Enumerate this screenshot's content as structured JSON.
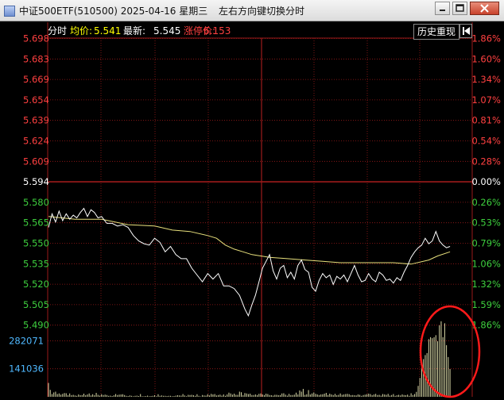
{
  "window": {
    "title": "中证500ETF(510500) 2025-04-16 星期三",
    "hint": "左右方向键切换分时"
  },
  "header": {
    "mode_label": "分时",
    "avg_label": "均价:",
    "avg_value": "5.541",
    "latest_label": "最新:",
    "latest_value": "5.545",
    "limit_label": "涨停价:",
    "limit_value": "6.153",
    "history_button": "历史重现"
  },
  "colors": {
    "up": "#ff4040",
    "down": "#3ecf3e",
    "flat": "#ffffff",
    "price_line": "#ffffff",
    "avg_line": "#e8e07c",
    "grid": "#9c1a1a",
    "volume": "#d9d9a8",
    "volume_label": "#4fb8ff",
    "header_avg": "#ffff00",
    "annotation": "#ff0000"
  },
  "chart_data": {
    "type": "line",
    "base_price": 5.594,
    "price_ticks": [
      "5.698",
      "5.683",
      "5.669",
      "5.654",
      "5.639",
      "5.624",
      "5.609",
      "5.594",
      "5.580",
      "5.565",
      "5.550",
      "5.535",
      "5.520",
      "5.505",
      "5.490"
    ],
    "pct_ticks": [
      "1.86%",
      "1.60%",
      "1.34%",
      "1.07%",
      "0.81%",
      "0.54%",
      "0.28%",
      "0.00%",
      "0.26%",
      "0.53%",
      "0.79%",
      "1.06%",
      "1.32%",
      "1.59%",
      "1.86%"
    ],
    "ylim": [
      5.483,
      5.698
    ],
    "volume_ticks": [
      "282071",
      "141036"
    ],
    "volume_max": 423107,
    "price_series": [
      [
        0,
        5.559
      ],
      [
        2,
        5.569
      ],
      [
        4,
        5.563
      ],
      [
        6,
        5.571
      ],
      [
        8,
        5.564
      ],
      [
        10,
        5.569
      ],
      [
        12,
        5.565
      ],
      [
        14,
        5.568
      ],
      [
        16,
        5.566
      ],
      [
        18,
        5.57
      ],
      [
        20,
        5.573
      ],
      [
        22,
        5.567
      ],
      [
        24,
        5.572
      ],
      [
        26,
        5.57
      ],
      [
        28,
        5.566
      ],
      [
        30,
        5.567
      ],
      [
        33,
        5.562
      ],
      [
        36,
        5.562
      ],
      [
        39,
        5.56
      ],
      [
        42,
        5.561
      ],
      [
        45,
        5.559
      ],
      [
        48,
        5.553
      ],
      [
        51,
        5.549
      ],
      [
        54,
        5.547
      ],
      [
        57,
        5.546
      ],
      [
        60,
        5.551
      ],
      [
        63,
        5.548
      ],
      [
        66,
        5.541
      ],
      [
        69,
        5.545
      ],
      [
        72,
        5.539
      ],
      [
        75,
        5.536
      ],
      [
        78,
        5.536
      ],
      [
        81,
        5.529
      ],
      [
        84,
        5.524
      ],
      [
        87,
        5.519
      ],
      [
        90,
        5.525
      ],
      [
        93,
        5.521
      ],
      [
        96,
        5.525
      ],
      [
        99,
        5.516
      ],
      [
        102,
        5.516
      ],
      [
        105,
        5.514
      ],
      [
        108,
        5.509
      ],
      [
        111,
        5.499
      ],
      [
        113,
        5.494
      ],
      [
        115,
        5.502
      ],
      [
        117,
        5.509
      ],
      [
        119,
        5.519
      ],
      [
        121,
        5.529
      ],
      [
        123,
        5.534
      ],
      [
        125,
        5.539
      ],
      [
        127,
        5.527
      ],
      [
        129,
        5.521
      ],
      [
        131,
        5.529
      ],
      [
        133,
        5.531
      ],
      [
        135,
        5.522
      ],
      [
        137,
        5.526
      ],
      [
        139,
        5.521
      ],
      [
        141,
        5.531
      ],
      [
        143,
        5.535
      ],
      [
        145,
        5.528
      ],
      [
        147,
        5.526
      ],
      [
        149,
        5.515
      ],
      [
        151,
        5.512
      ],
      [
        153,
        5.52
      ],
      [
        155,
        5.525
      ],
      [
        157,
        5.522
      ],
      [
        159,
        5.524
      ],
      [
        161,
        5.517
      ],
      [
        163,
        5.523
      ],
      [
        165,
        5.521
      ],
      [
        167,
        5.524
      ],
      [
        169,
        5.519
      ],
      [
        171,
        5.525
      ],
      [
        173,
        5.531
      ],
      [
        175,
        5.524
      ],
      [
        177,
        5.519
      ],
      [
        179,
        5.52
      ],
      [
        181,
        5.525
      ],
      [
        183,
        5.521
      ],
      [
        185,
        5.519
      ],
      [
        187,
        5.526
      ],
      [
        189,
        5.524
      ],
      [
        191,
        5.52
      ],
      [
        193,
        5.521
      ],
      [
        195,
        5.518
      ],
      [
        197,
        5.522
      ],
      [
        199,
        5.52
      ],
      [
        201,
        5.526
      ],
      [
        203,
        5.531
      ],
      [
        205,
        5.537
      ],
      [
        207,
        5.541
      ],
      [
        209,
        5.544
      ],
      [
        211,
        5.546
      ],
      [
        213,
        5.551
      ],
      [
        215,
        5.547
      ],
      [
        217,
        5.549
      ],
      [
        219,
        5.556
      ],
      [
        221,
        5.549
      ],
      [
        223,
        5.546
      ],
      [
        225,
        5.544
      ],
      [
        227,
        5.545
      ]
    ],
    "avg_series": [
      [
        0,
        5.567
      ],
      [
        15,
        5.565
      ],
      [
        30,
        5.565
      ],
      [
        45,
        5.561
      ],
      [
        60,
        5.56
      ],
      [
        70,
        5.557
      ],
      [
        80,
        5.556
      ],
      [
        90,
        5.553
      ],
      [
        95,
        5.551
      ],
      [
        100,
        5.546
      ],
      [
        105,
        5.543
      ],
      [
        110,
        5.541
      ],
      [
        115,
        5.539
      ],
      [
        125,
        5.537
      ],
      [
        135,
        5.536
      ],
      [
        145,
        5.535
      ],
      [
        155,
        5.534
      ],
      [
        165,
        5.533
      ],
      [
        175,
        5.533
      ],
      [
        185,
        5.533
      ],
      [
        195,
        5.533
      ],
      [
        205,
        5.532
      ],
      [
        215,
        5.535
      ],
      [
        220,
        5.538
      ],
      [
        227,
        5.541
      ]
    ],
    "volume_series": [
      [
        0,
        70000
      ],
      [
        1,
        35000
      ],
      [
        2,
        14000
      ],
      [
        3,
        22000
      ],
      [
        4,
        26000
      ],
      [
        5,
        14000
      ],
      [
        6,
        17000
      ],
      [
        7,
        11000
      ],
      [
        8,
        15000
      ],
      [
        9,
        19000
      ],
      [
        10,
        18000
      ],
      [
        11,
        8000
      ],
      [
        12,
        17000
      ],
      [
        13,
        8000
      ],
      [
        14,
        10000
      ],
      [
        15,
        7000
      ],
      [
        16,
        5000
      ],
      [
        17,
        12000
      ],
      [
        18,
        8000
      ],
      [
        19,
        9000
      ],
      [
        20,
        16000
      ],
      [
        21,
        8000
      ],
      [
        22,
        12000
      ],
      [
        23,
        17000
      ],
      [
        24,
        7000
      ],
      [
        25,
        13000
      ],
      [
        26,
        8000
      ],
      [
        27,
        20000
      ],
      [
        28,
        10000
      ],
      [
        29,
        6000
      ],
      [
        30,
        13000
      ],
      [
        31,
        9000
      ],
      [
        32,
        11000
      ],
      [
        33,
        9000
      ],
      [
        34,
        5000
      ],
      [
        35,
        6000
      ],
      [
        36,
        4000
      ],
      [
        37,
        8000
      ],
      [
        38,
        14000
      ],
      [
        39,
        9000
      ],
      [
        40,
        11000
      ],
      [
        41,
        12000
      ],
      [
        42,
        13000
      ],
      [
        43,
        9000
      ],
      [
        44,
        5000
      ],
      [
        45,
        4000
      ],
      [
        46,
        7000
      ],
      [
        47,
        5000
      ],
      [
        48,
        3000
      ],
      [
        49,
        5000
      ],
      [
        50,
        6000
      ],
      [
        51,
        4000
      ],
      [
        52,
        14000
      ],
      [
        53,
        3000
      ],
      [
        54,
        3000
      ],
      [
        55,
        4000
      ],
      [
        56,
        6000
      ],
      [
        57,
        3000
      ],
      [
        58,
        4000
      ],
      [
        59,
        5000
      ],
      [
        60,
        8000
      ],
      [
        61,
        3000
      ],
      [
        62,
        13000
      ],
      [
        63,
        5000
      ],
      [
        64,
        7000
      ],
      [
        65,
        5000
      ],
      [
        66,
        5000
      ],
      [
        67,
        4000
      ],
      [
        68,
        5000
      ],
      [
        69,
        5000
      ],
      [
        70,
        3000
      ],
      [
        71,
        4000
      ],
      [
        72,
        6000
      ],
      [
        73,
        8000
      ],
      [
        74,
        7000
      ],
      [
        75,
        6000
      ],
      [
        76,
        14000
      ],
      [
        77,
        7000
      ],
      [
        78,
        3000
      ],
      [
        79,
        10000
      ],
      [
        80,
        9000
      ],
      [
        81,
        10000
      ],
      [
        82,
        8000
      ],
      [
        83,
        5000
      ],
      [
        84,
        13000
      ],
      [
        85,
        5000
      ],
      [
        86,
        2000
      ],
      [
        87,
        9000
      ],
      [
        88,
        7000
      ],
      [
        89,
        6000
      ],
      [
        90,
        13000
      ],
      [
        91,
        7000
      ],
      [
        92,
        15000
      ],
      [
        93,
        12000
      ],
      [
        94,
        14000
      ],
      [
        95,
        7000
      ],
      [
        96,
        9000
      ],
      [
        97,
        11000
      ],
      [
        98,
        6000
      ],
      [
        99,
        12000
      ],
      [
        100,
        5000
      ],
      [
        101,
        12000
      ],
      [
        102,
        21000
      ],
      [
        103,
        17000
      ],
      [
        104,
        11000
      ],
      [
        105,
        16000
      ],
      [
        106,
        10000
      ],
      [
        107,
        10000
      ],
      [
        108,
        26000
      ],
      [
        109,
        23000
      ],
      [
        110,
        8000
      ],
      [
        111,
        19000
      ],
      [
        112,
        17000
      ],
      [
        113,
        14000
      ],
      [
        114,
        16000
      ],
      [
        115,
        9000
      ],
      [
        116,
        9000
      ],
      [
        117,
        12000
      ],
      [
        118,
        9000
      ],
      [
        119,
        15000
      ],
      [
        120,
        17000
      ],
      [
        121,
        12000
      ],
      [
        122,
        9000
      ],
      [
        123,
        16000
      ],
      [
        124,
        14000
      ],
      [
        125,
        9000
      ],
      [
        126,
        8000
      ],
      [
        127,
        6000
      ],
      [
        128,
        10000
      ],
      [
        129,
        10000
      ],
      [
        130,
        8000
      ],
      [
        131,
        9000
      ],
      [
        132,
        17000
      ],
      [
        133,
        18000
      ],
      [
        134,
        11000
      ],
      [
        135,
        6000
      ],
      [
        136,
        15000
      ],
      [
        137,
        9000
      ],
      [
        138,
        9000
      ],
      [
        139,
        11000
      ],
      [
        140,
        21000
      ],
      [
        141,
        12000
      ],
      [
        142,
        32000
      ],
      [
        143,
        26000
      ],
      [
        144,
        40000
      ],
      [
        145,
        10000
      ],
      [
        146,
        13000
      ],
      [
        147,
        34000
      ],
      [
        148,
        12000
      ],
      [
        149,
        17000
      ],
      [
        150,
        22000
      ],
      [
        151,
        15000
      ],
      [
        152,
        12000
      ],
      [
        153,
        9000
      ],
      [
        154,
        12000
      ],
      [
        155,
        13000
      ],
      [
        156,
        16000
      ],
      [
        157,
        20000
      ],
      [
        158,
        9000
      ],
      [
        159,
        16000
      ],
      [
        160,
        12000
      ],
      [
        161,
        9000
      ],
      [
        162,
        15000
      ],
      [
        163,
        8000
      ],
      [
        164,
        10000
      ],
      [
        165,
        17000
      ],
      [
        166,
        10000
      ],
      [
        167,
        12000
      ],
      [
        168,
        14000
      ],
      [
        169,
        15000
      ],
      [
        170,
        13000
      ],
      [
        171,
        8000
      ],
      [
        172,
        9000
      ],
      [
        173,
        8000
      ],
      [
        174,
        7000
      ],
      [
        175,
        12000
      ],
      [
        176,
        10000
      ],
      [
        177,
        5000
      ],
      [
        178,
        9000
      ],
      [
        179,
        11000
      ],
      [
        180,
        13000
      ],
      [
        181,
        16000
      ],
      [
        182,
        14000
      ],
      [
        183,
        8000
      ],
      [
        184,
        12000
      ],
      [
        185,
        15000
      ],
      [
        186,
        9000
      ],
      [
        187,
        10000
      ],
      [
        188,
        6000
      ],
      [
        189,
        14000
      ],
      [
        190,
        12000
      ],
      [
        191,
        10000
      ],
      [
        192,
        15000
      ],
      [
        193,
        6000
      ],
      [
        194,
        9000
      ],
      [
        195,
        14000
      ],
      [
        196,
        5000
      ],
      [
        197,
        8000
      ],
      [
        198,
        10000
      ],
      [
        199,
        7000
      ],
      [
        200,
        12000
      ],
      [
        201,
        9000
      ],
      [
        202,
        8000
      ],
      [
        203,
        11000
      ],
      [
        204,
        5000
      ],
      [
        205,
        18000
      ],
      [
        206,
        9000
      ],
      [
        207,
        14000
      ],
      [
        208,
        25000
      ],
      [
        209,
        55000
      ],
      [
        210,
        95000
      ],
      [
        211,
        150000
      ],
      [
        212,
        190000
      ],
      [
        213,
        210000
      ],
      [
        214,
        220000
      ],
      [
        215,
        290000
      ],
      [
        216,
        300000
      ],
      [
        217,
        295000
      ],
      [
        218,
        300000
      ],
      [
        219,
        310000
      ],
      [
        220,
        280000
      ],
      [
        221,
        360000
      ],
      [
        222,
        380000
      ],
      [
        223,
        300000
      ],
      [
        224,
        370000
      ],
      [
        225,
        260000
      ],
      [
        226,
        200000
      ],
      [
        227,
        140000
      ]
    ]
  }
}
